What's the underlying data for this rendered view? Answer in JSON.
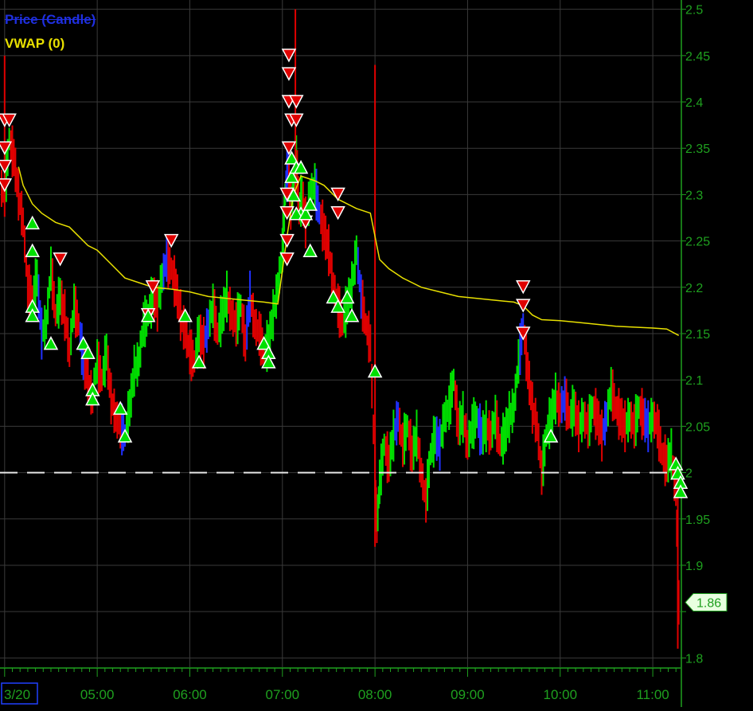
{
  "legend": {
    "price_label": "Price (Candle)",
    "vwap_label": "VWAP (0)"
  },
  "colors": {
    "background": "#000000",
    "grid": "#3a3a3a",
    "axis_text": "#1fa01f",
    "up_candle": "#00e000",
    "down_candle": "#e00000",
    "neutral_candle": "#2030ff",
    "vwap_line": "#e8e000",
    "reference_line": "#e6e6e6",
    "buy_marker": "#00e000",
    "sell_marker": "#e00000"
  },
  "chart_data": {
    "type": "candlestick",
    "title": "",
    "y_axis": {
      "ticks": [
        2.5,
        2.45,
        2.4,
        2.35,
        2.3,
        2.25,
        2.2,
        2.15,
        2.1,
        2.05,
        2.0,
        1.95,
        1.9,
        1.85,
        1.8
      ],
      "tick_labels": [
        "2.5",
        "2.45",
        "2.4",
        "2.35",
        "2.3",
        "2.25",
        "2.2",
        "2.15",
        "2.1",
        "2.05",
        "2",
        "1.95",
        "1.9",
        "",
        "1.8"
      ],
      "ylim": [
        1.79,
        2.51
      ],
      "side": "right"
    },
    "x_axis": {
      "ticks": [
        4.0,
        5.0,
        6.0,
        7.0,
        8.0,
        9.0,
        10.0,
        11.0
      ],
      "tick_labels": [
        "3/20",
        "05:00",
        "06:00",
        "07:00",
        "08:00",
        "09:00",
        "10:00",
        "11:00"
      ],
      "xlim": [
        3.95,
        11.3
      ]
    },
    "grid": true,
    "last_price": 1.86,
    "last_price_label": "1.86",
    "reference_level": 2.0,
    "price_series": [
      [
        3.95,
        2.31
      ],
      [
        4.0,
        2.3
      ],
      [
        4.05,
        2.36
      ],
      [
        4.1,
        2.34
      ],
      [
        4.15,
        2.3
      ],
      [
        4.2,
        2.27
      ],
      [
        4.25,
        2.2
      ],
      [
        4.3,
        2.19
      ],
      [
        4.35,
        2.21
      ],
      [
        4.4,
        2.15
      ],
      [
        4.45,
        2.16
      ],
      [
        4.5,
        2.22
      ],
      [
        4.55,
        2.17
      ],
      [
        4.6,
        2.19
      ],
      [
        4.65,
        2.17
      ],
      [
        4.7,
        2.13
      ],
      [
        4.75,
        2.18
      ],
      [
        4.8,
        2.16
      ],
      [
        4.85,
        2.12
      ],
      [
        4.9,
        2.1
      ],
      [
        4.95,
        2.08
      ],
      [
        5.0,
        2.12
      ],
      [
        5.05,
        2.1
      ],
      [
        5.1,
        2.13
      ],
      [
        5.15,
        2.08
      ],
      [
        5.2,
        2.06
      ],
      [
        5.25,
        2.05
      ],
      [
        5.3,
        2.04
      ],
      [
        5.35,
        2.07
      ],
      [
        5.4,
        2.11
      ],
      [
        5.45,
        2.12
      ],
      [
        5.5,
        2.16
      ],
      [
        5.55,
        2.17
      ],
      [
        5.6,
        2.19
      ],
      [
        5.65,
        2.18
      ],
      [
        5.7,
        2.21
      ],
      [
        5.75,
        2.23
      ],
      [
        5.8,
        2.22
      ],
      [
        5.85,
        2.2
      ],
      [
        5.9,
        2.17
      ],
      [
        5.95,
        2.15
      ],
      [
        6.0,
        2.13
      ],
      [
        6.05,
        2.12
      ],
      [
        6.1,
        2.15
      ],
      [
        6.15,
        2.14
      ],
      [
        6.2,
        2.16
      ],
      [
        6.25,
        2.18
      ],
      [
        6.3,
        2.15
      ],
      [
        6.35,
        2.17
      ],
      [
        6.4,
        2.19
      ],
      [
        6.45,
        2.17
      ],
      [
        6.5,
        2.16
      ],
      [
        6.55,
        2.18
      ],
      [
        6.6,
        2.14
      ],
      [
        6.65,
        2.19
      ],
      [
        6.7,
        2.16
      ],
      [
        6.75,
        2.15
      ],
      [
        6.8,
        2.13
      ],
      [
        6.85,
        2.14
      ],
      [
        6.9,
        2.17
      ],
      [
        6.95,
        2.2
      ],
      [
        7.0,
        2.24
      ],
      [
        7.03,
        2.3
      ],
      [
        7.06,
        2.33
      ],
      [
        7.09,
        2.29
      ],
      [
        7.12,
        2.31
      ],
      [
        7.15,
        2.34
      ],
      [
        7.18,
        2.28
      ],
      [
        7.21,
        2.3
      ],
      [
        7.25,
        2.27
      ],
      [
        7.3,
        2.3
      ],
      [
        7.35,
        2.31
      ],
      [
        7.4,
        2.28
      ],
      [
        7.45,
        2.26
      ],
      [
        7.5,
        2.24
      ],
      [
        7.55,
        2.2
      ],
      [
        7.6,
        2.18
      ],
      [
        7.65,
        2.16
      ],
      [
        7.7,
        2.18
      ],
      [
        7.75,
        2.2
      ],
      [
        7.8,
        2.24
      ],
      [
        7.85,
        2.19
      ],
      [
        7.9,
        2.16
      ],
      [
        7.95,
        2.14
      ],
      [
        8.0,
        2.0
      ],
      [
        8.02,
        1.94
      ],
      [
        8.05,
        1.99
      ],
      [
        8.1,
        2.03
      ],
      [
        8.15,
        2.01
      ],
      [
        8.2,
        2.04
      ],
      [
        8.25,
        2.06
      ],
      [
        8.3,
        2.03
      ],
      [
        8.35,
        2.05
      ],
      [
        8.4,
        2.02
      ],
      [
        8.45,
        2.04
      ],
      [
        8.5,
        2.0
      ],
      [
        8.55,
        1.97
      ],
      [
        8.6,
        2.02
      ],
      [
        8.65,
        2.04
      ],
      [
        8.7,
        2.03
      ],
      [
        8.75,
        2.06
      ],
      [
        8.8,
        2.07
      ],
      [
        8.85,
        2.1
      ],
      [
        8.9,
        2.05
      ],
      [
        8.95,
        2.06
      ],
      [
        9.0,
        2.03
      ],
      [
        9.05,
        2.05
      ],
      [
        9.1,
        2.06
      ],
      [
        9.15,
        2.04
      ],
      [
        9.2,
        2.05
      ],
      [
        9.25,
        2.04
      ],
      [
        9.3,
        2.06
      ],
      [
        9.35,
        2.03
      ],
      [
        9.4,
        2.04
      ],
      [
        9.45,
        2.06
      ],
      [
        9.5,
        2.07
      ],
      [
        9.55,
        2.12
      ],
      [
        9.6,
        2.16
      ],
      [
        9.65,
        2.11
      ],
      [
        9.7,
        2.07
      ],
      [
        9.75,
        2.05
      ],
      [
        9.8,
        2.0
      ],
      [
        9.85,
        2.04
      ],
      [
        9.9,
        2.06
      ],
      [
        9.95,
        2.08
      ],
      [
        10.0,
        2.07
      ],
      [
        10.05,
        2.08
      ],
      [
        10.1,
        2.06
      ],
      [
        10.15,
        2.07
      ],
      [
        10.2,
        2.05
      ],
      [
        10.25,
        2.06
      ],
      [
        10.3,
        2.05
      ],
      [
        10.35,
        2.07
      ],
      [
        10.4,
        2.06
      ],
      [
        10.45,
        2.04
      ],
      [
        10.5,
        2.06
      ],
      [
        10.55,
        2.09
      ],
      [
        10.6,
        2.07
      ],
      [
        10.65,
        2.06
      ],
      [
        10.7,
        2.05
      ],
      [
        10.75,
        2.06
      ],
      [
        10.8,
        2.05
      ],
      [
        10.85,
        2.07
      ],
      [
        10.9,
        2.06
      ],
      [
        10.95,
        2.05
      ],
      [
        11.0,
        2.06
      ],
      [
        11.05,
        2.05
      ],
      [
        11.1,
        2.02
      ],
      [
        11.15,
        2.01
      ],
      [
        11.2,
        2.02
      ],
      [
        11.25,
        1.98
      ],
      [
        11.28,
        1.86
      ]
    ],
    "spikes": [
      {
        "x": 4.0,
        "high": 2.45,
        "low": 2.29
      },
      {
        "x": 7.14,
        "high": 2.5,
        "low": 2.3
      },
      {
        "x": 8.0,
        "high": 2.44,
        "low": 1.92
      },
      {
        "x": 11.27,
        "high": 2.0,
        "low": 1.81
      }
    ],
    "vwap": [
      [
        4.15,
        2.33
      ],
      [
        4.2,
        2.31
      ],
      [
        4.3,
        2.29
      ],
      [
        4.4,
        2.28
      ],
      [
        4.55,
        2.27
      ],
      [
        4.7,
        2.265
      ],
      [
        4.8,
        2.255
      ],
      [
        4.9,
        2.245
      ],
      [
        5.0,
        2.24
      ],
      [
        5.1,
        2.23
      ],
      [
        5.2,
        2.22
      ],
      [
        5.3,
        2.21
      ],
      [
        5.45,
        2.205
      ],
      [
        5.6,
        2.2
      ],
      [
        5.8,
        2.198
      ],
      [
        6.0,
        2.195
      ],
      [
        6.2,
        2.19
      ],
      [
        6.4,
        2.188
      ],
      [
        6.6,
        2.186
      ],
      [
        6.8,
        2.184
      ],
      [
        6.95,
        2.182
      ],
      [
        7.05,
        2.255
      ],
      [
        7.12,
        2.3
      ],
      [
        7.2,
        2.32
      ],
      [
        7.35,
        2.315
      ],
      [
        7.45,
        2.31
      ],
      [
        7.6,
        2.295
      ],
      [
        7.8,
        2.285
      ],
      [
        7.95,
        2.28
      ],
      [
        8.0,
        2.255
      ],
      [
        8.05,
        2.23
      ],
      [
        8.15,
        2.22
      ],
      [
        8.3,
        2.21
      ],
      [
        8.5,
        2.2
      ],
      [
        8.7,
        2.195
      ],
      [
        8.9,
        2.19
      ],
      [
        9.1,
        2.188
      ],
      [
        9.3,
        2.186
      ],
      [
        9.5,
        2.184
      ],
      [
        9.6,
        2.18
      ],
      [
        9.7,
        2.17
      ],
      [
        9.8,
        2.165
      ],
      [
        10.0,
        2.164
      ],
      [
        10.2,
        2.162
      ],
      [
        10.4,
        2.16
      ],
      [
        10.6,
        2.158
      ],
      [
        10.8,
        2.157
      ],
      [
        11.0,
        2.156
      ],
      [
        11.15,
        2.155
      ],
      [
        11.28,
        2.148
      ]
    ],
    "sell_markers": [
      [
        4.0,
        2.38
      ],
      [
        4.0,
        2.35
      ],
      [
        4.0,
        2.33
      ],
      [
        4.0,
        2.31
      ],
      [
        4.05,
        2.38
      ],
      [
        4.6,
        2.23
      ],
      [
        5.55,
        2.17
      ],
      [
        5.6,
        2.2
      ],
      [
        5.8,
        2.25
      ],
      [
        7.07,
        2.45
      ],
      [
        7.07,
        2.43
      ],
      [
        7.07,
        2.4
      ],
      [
        7.1,
        2.38
      ],
      [
        7.15,
        2.38
      ],
      [
        7.15,
        2.4
      ],
      [
        7.07,
        2.35
      ],
      [
        7.05,
        2.3
      ],
      [
        7.05,
        2.28
      ],
      [
        7.05,
        2.25
      ],
      [
        7.05,
        2.23
      ],
      [
        7.25,
        2.27
      ],
      [
        7.6,
        2.3
      ],
      [
        7.6,
        2.28
      ],
      [
        9.6,
        2.2
      ],
      [
        9.6,
        2.18
      ],
      [
        9.6,
        2.15
      ]
    ],
    "buy_markers": [
      [
        4.3,
        2.27
      ],
      [
        4.3,
        2.24
      ],
      [
        4.3,
        2.18
      ],
      [
        4.3,
        2.17
      ],
      [
        4.5,
        2.14
      ],
      [
        4.85,
        2.14
      ],
      [
        4.9,
        2.13
      ],
      [
        4.95,
        2.09
      ],
      [
        4.95,
        2.08
      ],
      [
        5.25,
        2.07
      ],
      [
        5.3,
        2.04
      ],
      [
        5.55,
        2.17
      ],
      [
        5.95,
        2.17
      ],
      [
        6.1,
        2.12
      ],
      [
        6.8,
        2.14
      ],
      [
        6.85,
        2.13
      ],
      [
        6.85,
        2.12
      ],
      [
        7.1,
        2.34
      ],
      [
        7.1,
        2.32
      ],
      [
        7.12,
        2.3
      ],
      [
        7.15,
        2.33
      ],
      [
        7.2,
        2.33
      ],
      [
        7.2,
        2.28
      ],
      [
        7.15,
        2.28
      ],
      [
        7.25,
        2.28
      ],
      [
        7.3,
        2.29
      ],
      [
        7.3,
        2.24
      ],
      [
        7.55,
        2.19
      ],
      [
        7.6,
        2.18
      ],
      [
        7.7,
        2.19
      ],
      [
        7.75,
        2.17
      ],
      [
        8.0,
        2.11
      ],
      [
        9.9,
        2.04
      ],
      [
        11.25,
        2.01
      ],
      [
        11.27,
        2.0
      ],
      [
        11.3,
        1.99
      ],
      [
        11.3,
        1.98
      ]
    ]
  }
}
